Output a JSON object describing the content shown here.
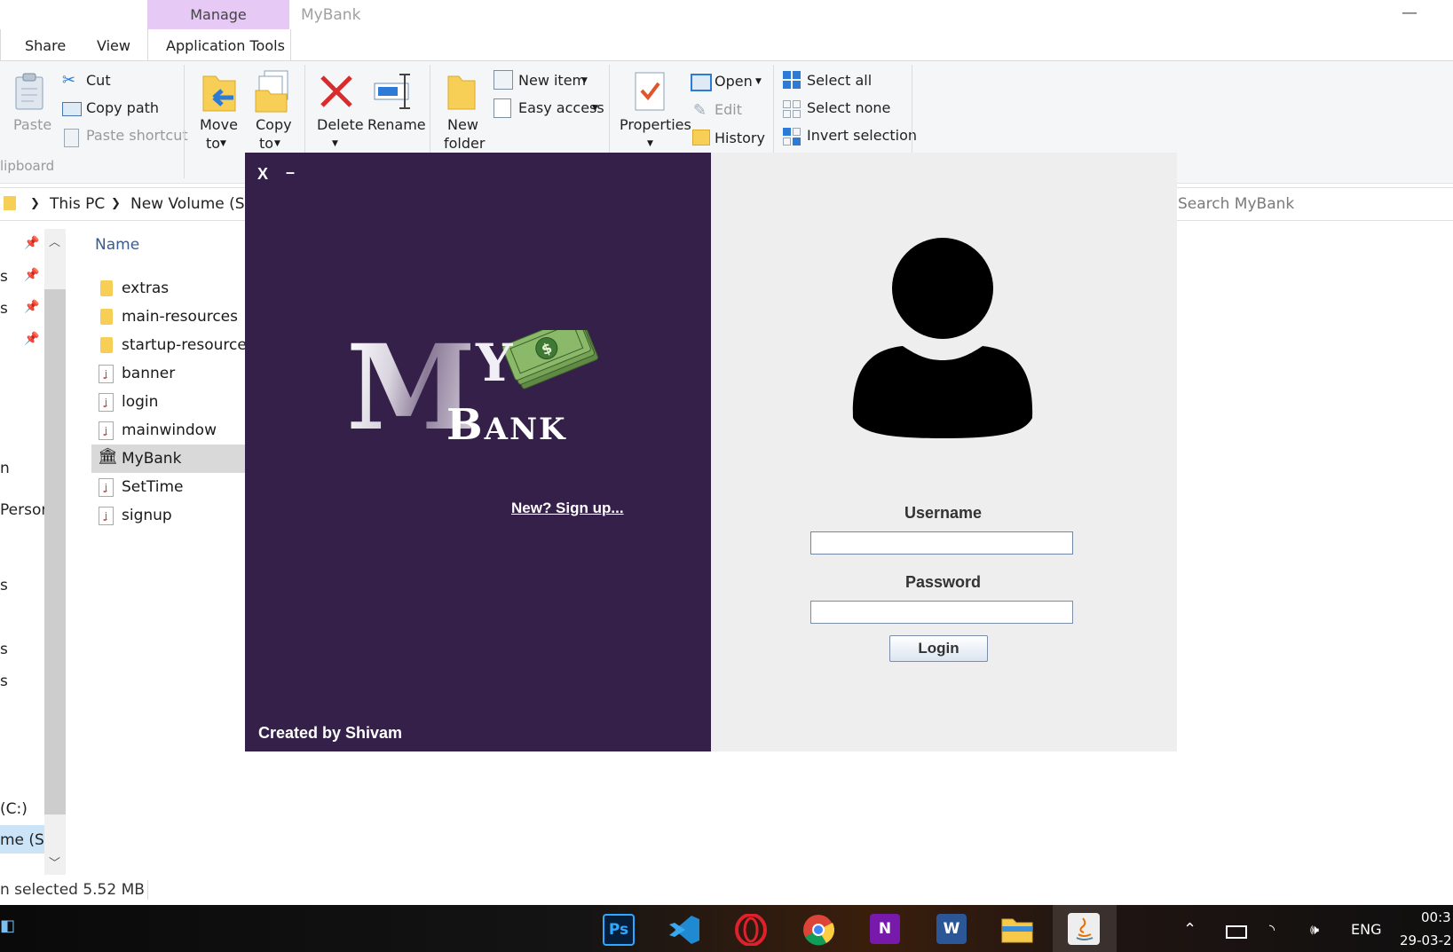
{
  "explorer": {
    "title_tab": "Manage",
    "window_title": "MyBank",
    "minimize_glyph": "—",
    "tabs": [
      "Share",
      "View",
      "Application Tools"
    ],
    "ribbon": {
      "clipboard": {
        "paste": "Paste",
        "cut": "Cut",
        "copy_path": "Copy path",
        "paste_shortcut": "Paste shortcut",
        "group_label": "lipboard"
      },
      "organize": {
        "move_to_1": "Move",
        "move_to_2": "to",
        "copy_to_1": "Copy",
        "copy_to_2": "to",
        "delete": "Delete",
        "rename": "Rename"
      },
      "new": {
        "new_folder_1": "New",
        "new_folder_2": "folder",
        "new_item": "New item",
        "easy_access": "Easy access"
      },
      "open": {
        "properties": "Properties",
        "open": "Open",
        "edit": "Edit",
        "history": "History"
      },
      "select": {
        "select_all": "Select all",
        "select_none": "Select none",
        "invert_selection": "Invert selection"
      }
    },
    "address": {
      "crumbs": [
        "This PC",
        "New Volume (S:)"
      ]
    },
    "search": {
      "placeholder": "Search MyBank"
    },
    "nav_pane": {
      "items": [
        "s",
        "s",
        "n",
        "Person",
        "s",
        "s",
        "s",
        "(C:)",
        "me (S:)"
      ]
    },
    "file_list": {
      "column_name": "Name",
      "files": [
        {
          "name": "extras",
          "type": "folder"
        },
        {
          "name": "main-resources",
          "type": "folder"
        },
        {
          "name": "startup-resources",
          "type": "folder"
        },
        {
          "name": "banner",
          "type": "java"
        },
        {
          "name": "login",
          "type": "java"
        },
        {
          "name": "mainwindow",
          "type": "java"
        },
        {
          "name": "MyBank",
          "type": "app"
        },
        {
          "name": "SetTime",
          "type": "java"
        },
        {
          "name": "signup",
          "type": "java"
        }
      ]
    },
    "status": {
      "text": "n selected  5.52 MB"
    }
  },
  "app": {
    "close": "X",
    "minimize": "–",
    "logo": {
      "m": "M",
      "y": "Y",
      "bank": "Bank"
    },
    "signup_link": "New? Sign up...",
    "credit": "Created by Shivam",
    "username_label": "Username",
    "password_label": "Password",
    "username_value": "",
    "password_value": "",
    "login_button": "Login"
  },
  "taskbar": {
    "icons": [
      "Ps",
      "VS Code",
      "Opera",
      "Chrome",
      "N",
      "W",
      "File Explorer",
      "Java"
    ],
    "tray": {
      "language": "ENG",
      "time": "00:3",
      "date": "29-03-2"
    }
  },
  "colors": {
    "app_left_bg": "#35204a",
    "app_right_bg": "#eeeeee",
    "manage_tab": "#e6c9f5"
  }
}
